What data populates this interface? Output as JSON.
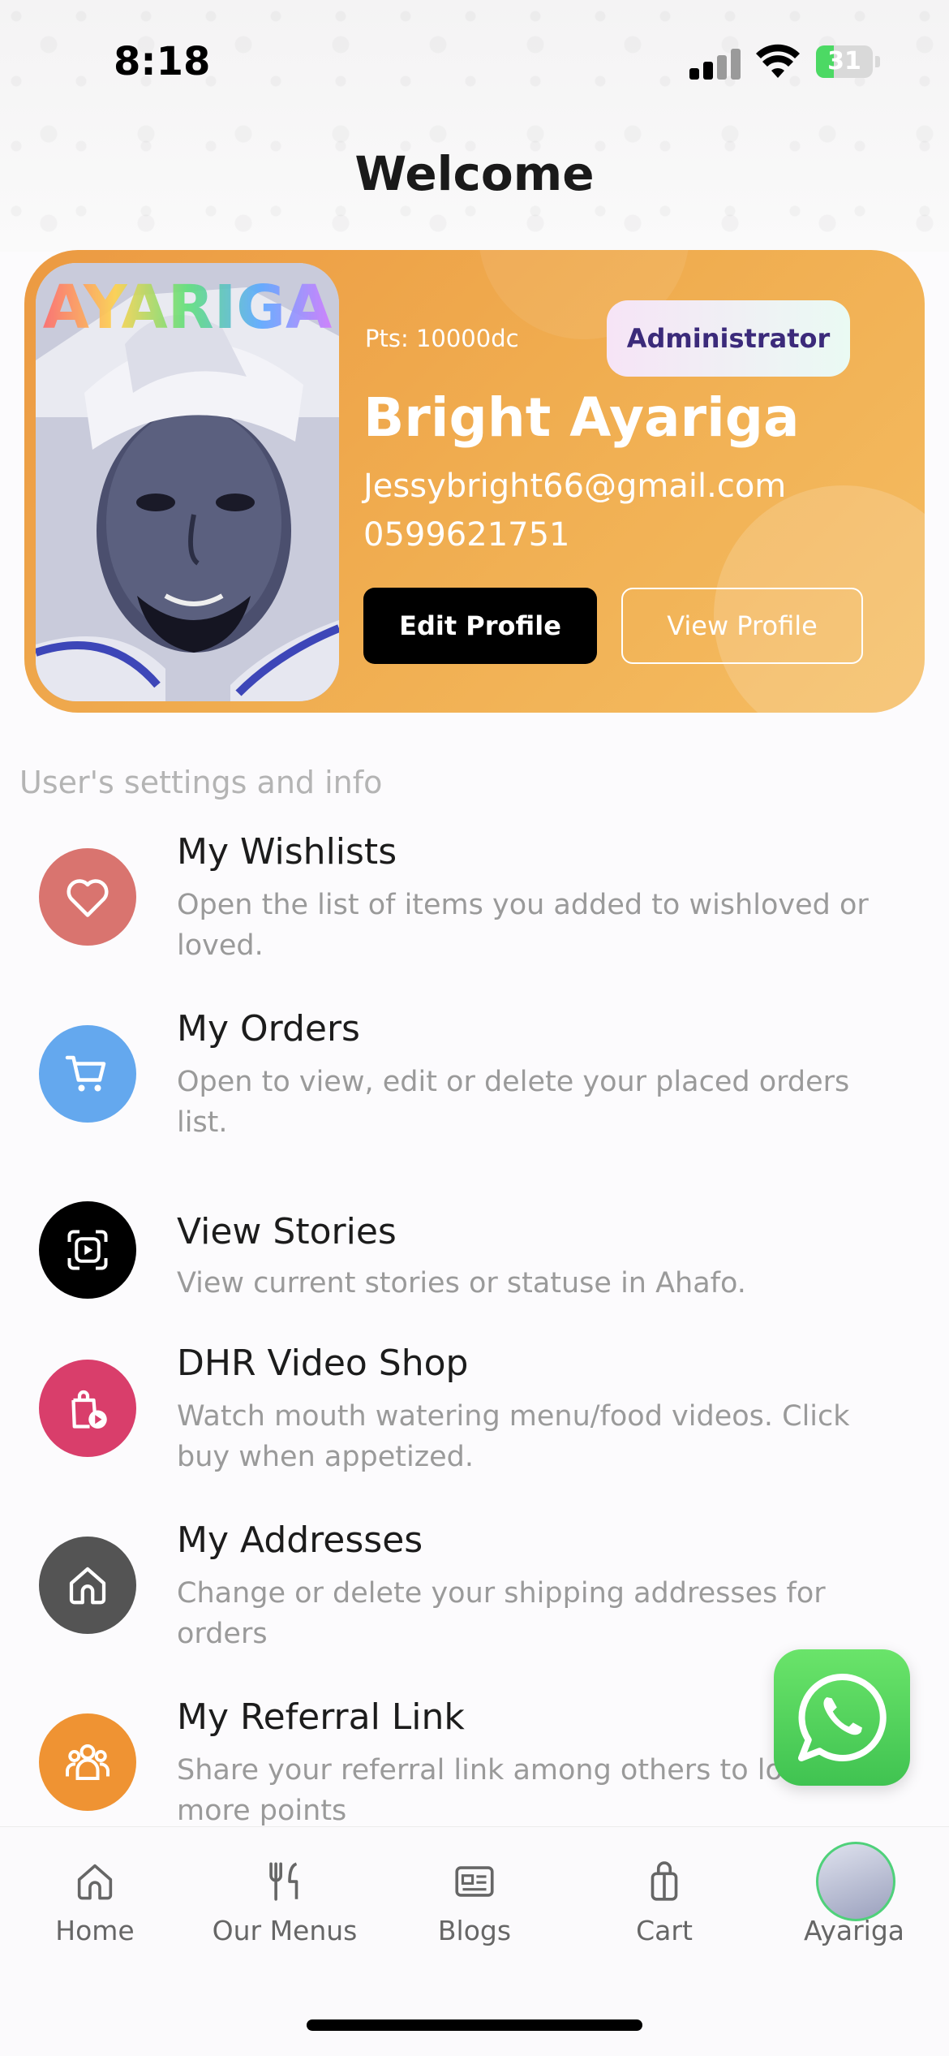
{
  "status_bar": {
    "time": "8:18",
    "battery": "31",
    "battery_fraction": 0.31
  },
  "header": {
    "title": "Welcome"
  },
  "profile": {
    "avatar_overlay_text": "AYARIGA",
    "points": "Pts: 10000dc",
    "role": "Administrator",
    "name": "Bright Ayariga",
    "email": "Jessybright66@gmail.com",
    "phone": "0599621751",
    "edit_button": "Edit Profile",
    "view_button": "View Profile"
  },
  "settings": {
    "section_label": "User's settings and info",
    "items": [
      {
        "title": "My Wishlists",
        "desc": "Open the list of items you added to wishloved or loved.",
        "icon": "heart-icon",
        "color": "#d9746f"
      },
      {
        "title": "My Orders",
        "desc": "Open to view, edit or delete your placed orders list.",
        "icon": "cart-icon",
        "color": "#64a8ee"
      },
      {
        "title": "View Stories",
        "desc": "View current stories or statuse in Ahafo.",
        "icon": "story-play-icon",
        "color": "#000000"
      },
      {
        "title": "DHR Video Shop",
        "desc": "Watch mouth watering menu/food videos. Click buy when appetized.",
        "icon": "video-shop-icon",
        "color": "#d93e6b"
      },
      {
        "title": "My Addresses",
        "desc": "Change or delete your shipping addresses for orders",
        "icon": "home-icon",
        "color": "#545454"
      },
      {
        "title": "My Referral Link",
        "desc": "Share your referral link among others to lore more points",
        "icon": "people-icon",
        "color": "#ef9333"
      }
    ]
  },
  "fab": {
    "icon": "whatsapp-icon",
    "color": "#4cd35c"
  },
  "tabs": [
    {
      "label": "Home",
      "icon": "home-icon"
    },
    {
      "label": "Our Menus",
      "icon": "utensils-icon"
    },
    {
      "label": "Blogs",
      "icon": "newspaper-icon"
    },
    {
      "label": "Cart",
      "icon": "bag-icon"
    },
    {
      "label": "Ayariga",
      "icon": "avatar"
    }
  ]
}
